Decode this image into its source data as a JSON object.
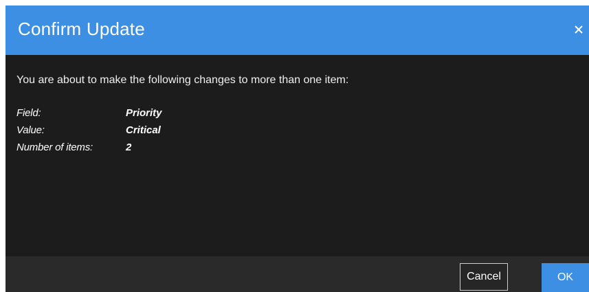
{
  "dialog": {
    "title": "Confirm Update",
    "close_icon": "close-icon",
    "intro": "You are about to make the following changes to more than one item:",
    "fields": [
      {
        "label": "Field:",
        "value": "Priority"
      },
      {
        "label": "Value:",
        "value": "Critical"
      },
      {
        "label": "Number of items:",
        "value": "2"
      }
    ],
    "cancel_label": "Cancel",
    "ok_label": "OK"
  },
  "colors": {
    "header_accent": "#3c8fe3",
    "body_background": "#1c1c1c",
    "footer_background": "#2a2a2a"
  }
}
